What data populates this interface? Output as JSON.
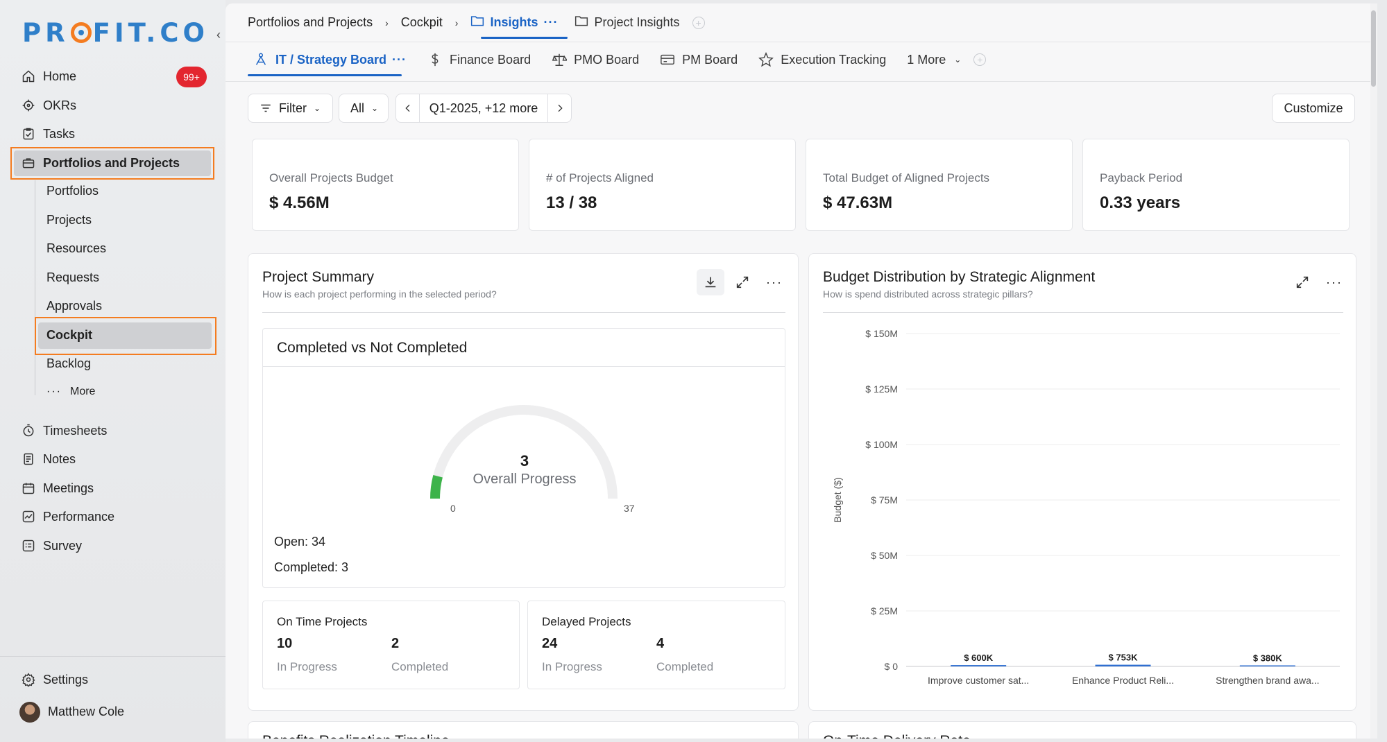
{
  "sidebar": {
    "logo": "PROFIT.CO",
    "nav": [
      {
        "label": "Home",
        "icon": "home-icon"
      },
      {
        "label": "OKRs",
        "icon": "target-icon"
      },
      {
        "label": "Tasks",
        "icon": "tasks-icon"
      },
      {
        "label": "Portfolios and Projects",
        "icon": "briefcase-icon"
      }
    ],
    "badge": "99+",
    "sub_items": [
      "Portfolios",
      "Projects",
      "Resources",
      "Requests",
      "Approvals",
      "Cockpit",
      "Backlog"
    ],
    "more_label": "More",
    "nav2": [
      {
        "label": "Timesheets",
        "icon": "timer-icon"
      },
      {
        "label": "Notes",
        "icon": "notes-icon"
      },
      {
        "label": "Meetings",
        "icon": "calendar-icon"
      },
      {
        "label": "Performance",
        "icon": "chart-icon"
      },
      {
        "label": "Survey",
        "icon": "survey-icon"
      }
    ],
    "settings_label": "Settings",
    "user_name": "Matthew Cole"
  },
  "breadcrumb": {
    "items": [
      "Portfolios and Projects",
      "Cockpit"
    ],
    "active_tab": "Insights",
    "second_tab": "Project Insights"
  },
  "board_tabs": {
    "active": "IT / Strategy Board",
    "tabs": [
      "Finance Board",
      "PMO Board",
      "PM Board",
      "Execution Tracking"
    ],
    "more": "1 More"
  },
  "controls": {
    "filter": "Filter",
    "scope": "All",
    "period": "Q1-2025, +12 more",
    "customize": "Customize"
  },
  "stats": [
    {
      "label": "Overall Projects Budget",
      "value": "$ 4.56M"
    },
    {
      "label": "# of Projects Aligned",
      "value": "13 / 38"
    },
    {
      "label": "Total Budget of Aligned Projects",
      "value": "$ 47.63M"
    },
    {
      "label": "Payback Period",
      "value": "0.33 years"
    }
  ],
  "project_summary": {
    "title": "Project Summary",
    "subtitle": "How is each project performing in the selected period?",
    "card_title": "Completed vs Not Completed",
    "gauge": {
      "value": "3",
      "label": "Overall Progress",
      "min": "0",
      "max": "37",
      "completed": 3,
      "total": 37,
      "color": "#3db34a"
    },
    "open": "Open: 34",
    "completed": "Completed: 3",
    "on_time": {
      "title": "On Time Projects",
      "in_progress": "10",
      "completed": "2",
      "in_progress_label": "In Progress",
      "completed_label": "Completed"
    },
    "delayed": {
      "title": "Delayed Projects",
      "in_progress": "24",
      "completed": "4",
      "in_progress_label": "In Progress",
      "completed_label": "Completed"
    }
  },
  "budget_panel": {
    "title": "Budget Distribution by Strategic Alignment",
    "subtitle": "How is spend distributed across strategic pillars?"
  },
  "chart_data": {
    "type": "bar",
    "categories": [
      "Improve customer sat...",
      "Enhance Product Reli...",
      "Strengthen brand awa..."
    ],
    "values": [
      600000,
      753000,
      380000
    ],
    "data_labels": [
      "$ 600K",
      "$ 753K",
      "$ 380K"
    ],
    "ylabel": "Budget ($)",
    "ylim": [
      0,
      150000000
    ],
    "yticks": [
      0,
      25000000,
      50000000,
      75000000,
      100000000,
      125000000,
      150000000
    ],
    "ytick_labels": [
      "$ 0",
      "$ 25M",
      "$ 50M",
      "$ 75M",
      "$ 100M",
      "$ 125M",
      "$ 150M"
    ],
    "grid": true,
    "bar_color": "#2f6fd1"
  },
  "bottom_panels": [
    "Benefits Realization Timeline",
    "On-Time Delivery Rate"
  ]
}
